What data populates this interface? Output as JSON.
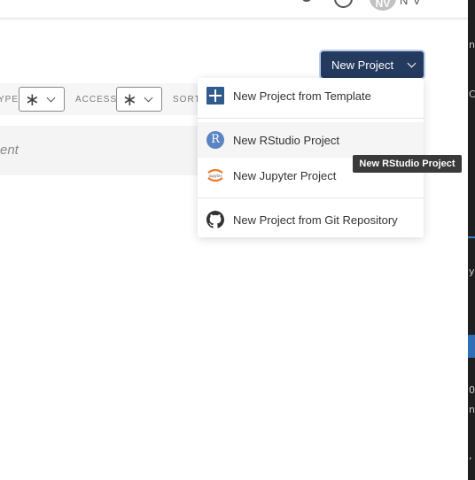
{
  "header": {
    "avatar_initials": "NV",
    "user_initials": "N V"
  },
  "toolbar": {
    "new_project_label": "New Project"
  },
  "filters": {
    "type_label": "YPE",
    "type_value": "∗",
    "access_label": "ACCESS",
    "access_value": "∗",
    "sort_label": "SORT"
  },
  "search": {
    "placeholder_fragment": "ent"
  },
  "menu": {
    "items": [
      {
        "label": "New Project from Template",
        "icon": "plus-square-icon"
      },
      {
        "label": "New RStudio Project",
        "icon": "rstudio-icon"
      },
      {
        "label": "New Jupyter Project",
        "icon": "jupyter-icon"
      },
      {
        "label": "New Project from Git Repository",
        "icon": "github-icon"
      }
    ]
  },
  "tooltip": {
    "text": "New RStudio Project"
  },
  "background_app": {
    "fragments": [
      "n",
      "C",
      "y",
      "0",
      "n",
      ","
    ]
  },
  "colors": {
    "primary_button": "#243a5e",
    "template_icon": "#2f5c8c",
    "rstudio_icon": "#5b84c4",
    "tooltip_bg": "#3a3a3a"
  }
}
